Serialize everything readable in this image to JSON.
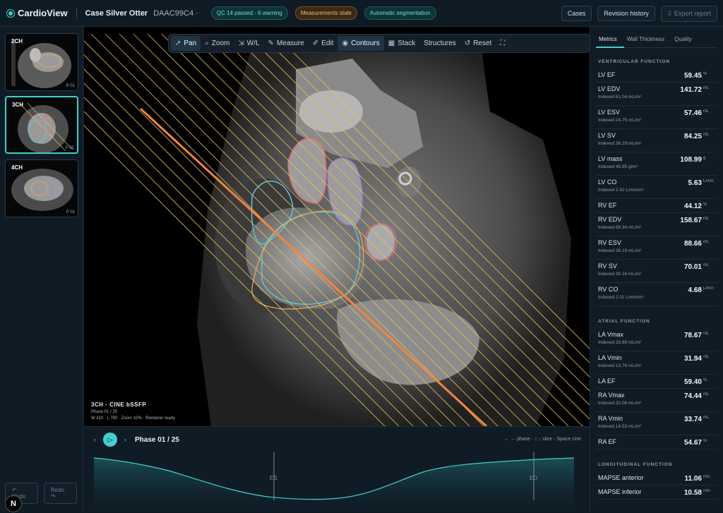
{
  "app": {
    "name": "CardioView",
    "case_name": "Case Silver Otter",
    "case_id": "DAAC99C4 ·"
  },
  "badges": {
    "qc": "QC  14 passed · 6 warning",
    "stale": "Measurements stale",
    "seg": "Automatic segmentation"
  },
  "header": {
    "cases": "Cases",
    "revision": "Revision history",
    "export": "Export report"
  },
  "thumbnails": [
    {
      "label": "2CH",
      "phase": "P 01"
    },
    {
      "label": "3CH",
      "phase": "P 01"
    },
    {
      "label": "4CH",
      "phase": "P 01"
    }
  ],
  "history": {
    "undo": "Undo",
    "redo": "Redo"
  },
  "toolbar": {
    "pan": "Pan",
    "zoom": "Zoom",
    "wl": "W/L",
    "measure": "Measure",
    "edit": "Edit",
    "contours": "Contours",
    "stack": "Stack",
    "structures": "Structures",
    "reset": "Reset"
  },
  "viewer": {
    "title": "3CH · CINE bSSFP",
    "phase": "Phase 01 / 25",
    "status": "W 410 · L 780 · Zoom 10% · Renderer ready"
  },
  "timeline": {
    "phase": "Phase 01 / 25",
    "hint": "← → phase · ↑ ↓ slice · Space cine",
    "es": "ES",
    "ed": "ED"
  },
  "colors": {
    "accent": "#3fd1cc",
    "warning": "#f0b871",
    "slice_line": "#f5853a",
    "stack_lines": "#e0c25a"
  },
  "panel": {
    "tabs": [
      "Metrics",
      "Wall Thickness",
      "Quality"
    ],
    "sections": [
      {
        "title": "VENTRICULAR FUNCTION",
        "rows": [
          {
            "name": "LV EF",
            "value": "59.45",
            "unit": "%",
            "sub": ""
          },
          {
            "name": "LV EDV",
            "value": "141.72",
            "unit": "mL",
            "sub": "Indexed 61.04 mL/m²"
          },
          {
            "name": "LV ESV",
            "value": "57.46",
            "unit": "mL",
            "sub": "Indexed 24.75 mL/m²"
          },
          {
            "name": "LV SV",
            "value": "84.25",
            "unit": "mL",
            "sub": "Indexed 36.29 mL/m²"
          },
          {
            "name": "LV mass",
            "value": "108.99",
            "unit": "g",
            "sub": "Indexed 46.95 g/m²"
          },
          {
            "name": "LV CO",
            "value": "5.63",
            "unit": "L/min",
            "sub": "Indexed 2.42 L/min/m²"
          },
          {
            "name": "RV EF",
            "value": "44.12",
            "unit": "%",
            "sub": ""
          },
          {
            "name": "RV EDV",
            "value": "158.67",
            "unit": "mL",
            "sub": "Indexed 68.34 mL/m²"
          },
          {
            "name": "RV ESV",
            "value": "88.66",
            "unit": "mL",
            "sub": "Indexed 38.19 mL/m²"
          },
          {
            "name": "RV SV",
            "value": "70.01",
            "unit": "mL",
            "sub": "Indexed 30.16 mL/m²"
          },
          {
            "name": "RV CO",
            "value": "4.68",
            "unit": "L/min",
            "sub": "Indexed 2.01 L/min/m²"
          }
        ]
      },
      {
        "title": "ATRIAL FUNCTION",
        "rows": [
          {
            "name": "LA Vmax",
            "value": "78.67",
            "unit": "mL",
            "sub": "Indexed 33.89 mL/m²"
          },
          {
            "name": "LA Vmin",
            "value": "31.94",
            "unit": "mL",
            "sub": "Indexed 13.76 mL/m²"
          },
          {
            "name": "LA EF",
            "value": "59.40",
            "unit": "%",
            "sub": ""
          },
          {
            "name": "RA Vmax",
            "value": "74.44",
            "unit": "mL",
            "sub": "Indexed 32.06 mL/m²"
          },
          {
            "name": "RA Vmin",
            "value": "33.74",
            "unit": "mL",
            "sub": "Indexed 14.53 mL/m²"
          },
          {
            "name": "RA EF",
            "value": "54.67",
            "unit": "%",
            "sub": ""
          }
        ]
      },
      {
        "title": "LONGITUDINAL FUNCTION",
        "rows": [
          {
            "name": "MAPSE anterior",
            "value": "11.06",
            "unit": "mm",
            "sub": ""
          },
          {
            "name": "MAPSE inferior",
            "value": "10.58",
            "unit": "mm",
            "sub": ""
          }
        ]
      }
    ]
  }
}
